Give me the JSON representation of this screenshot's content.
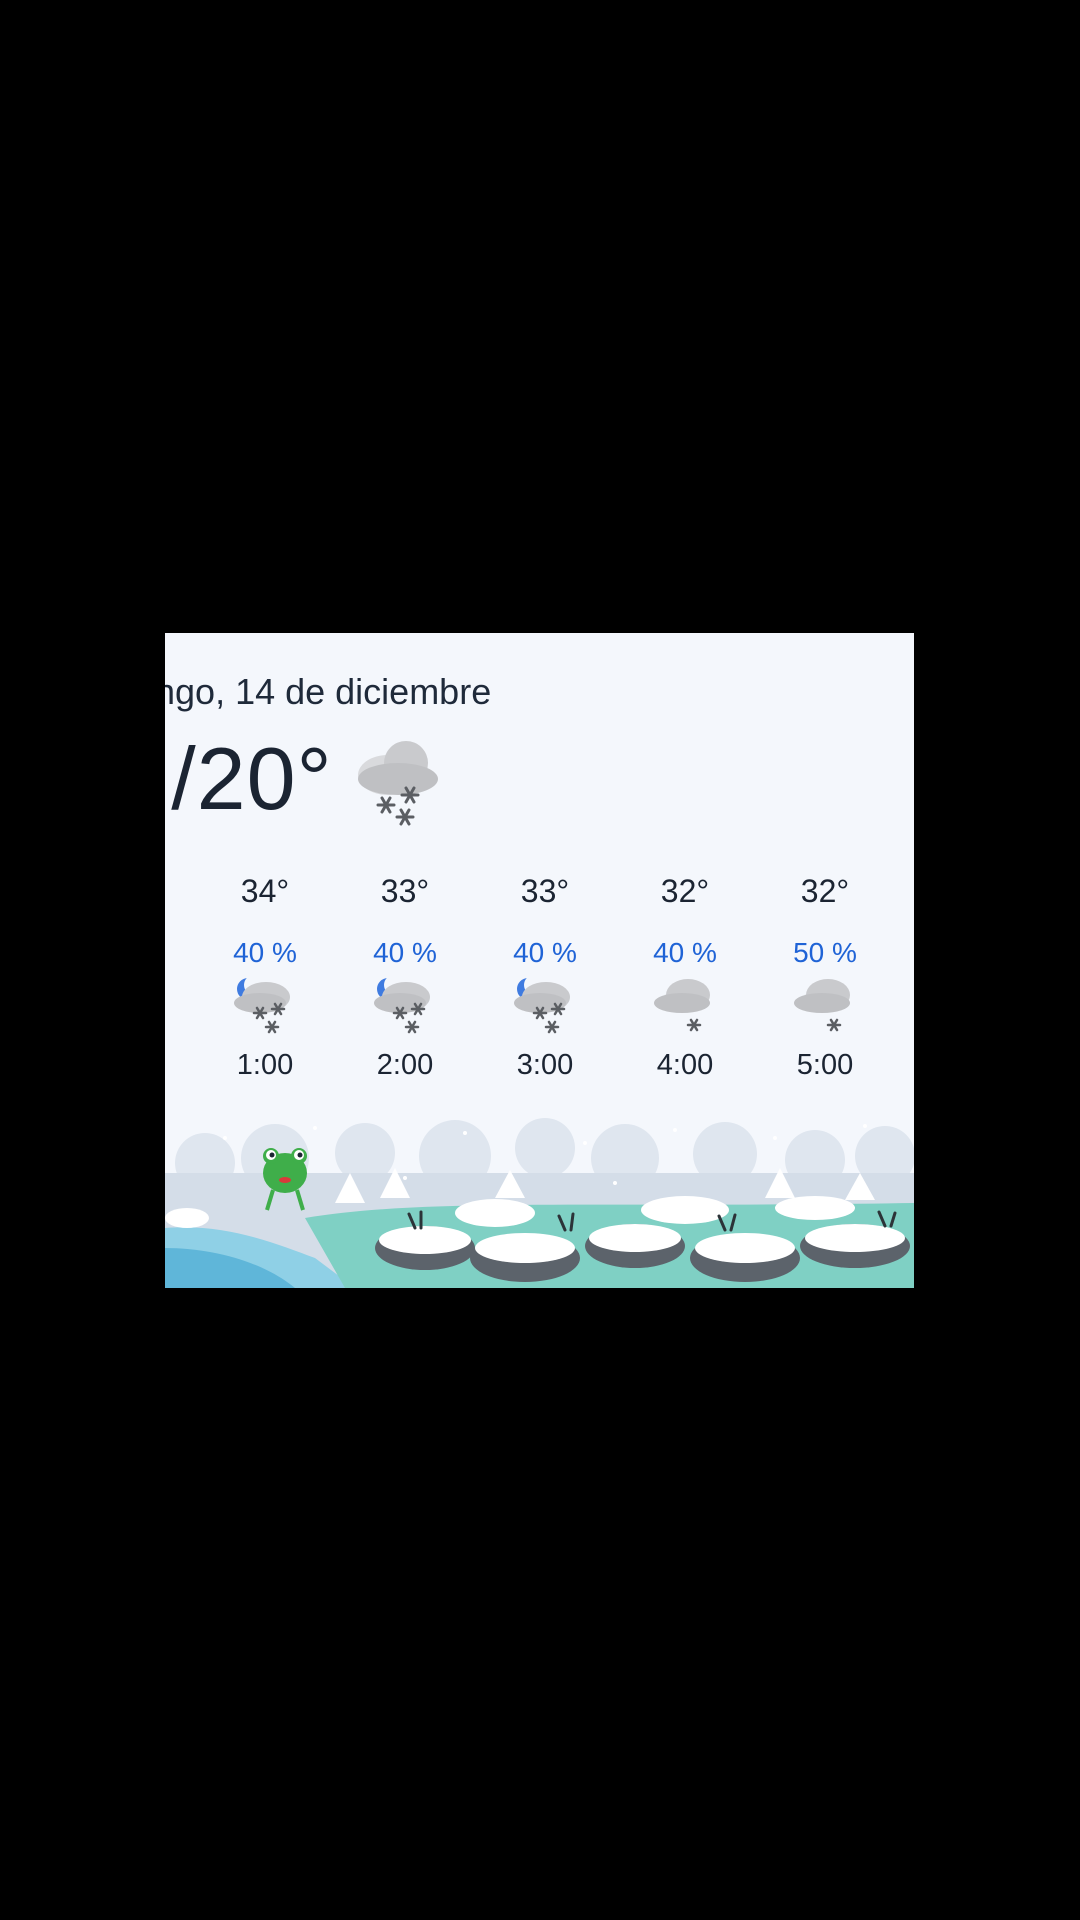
{
  "header": {
    "date": "ngo, 14 de diciembre",
    "temp_range": "°/20°",
    "icon": "snow-cloud-icon"
  },
  "hourly": [
    {
      "temp": "34°",
      "precip": "40 %",
      "time": "1:00",
      "icon": "night-snow-icon"
    },
    {
      "temp": "33°",
      "precip": "40 %",
      "time": "2:00",
      "icon": "night-snow-icon"
    },
    {
      "temp": "33°",
      "precip": "40 %",
      "time": "3:00",
      "icon": "night-snow-icon"
    },
    {
      "temp": "32°",
      "precip": "40 %",
      "time": "4:00",
      "icon": "light-snow-icon"
    },
    {
      "temp": "32°",
      "precip": "50 %",
      "time": "5:00",
      "icon": "light-snow-icon"
    }
  ],
  "colors": {
    "background": "#f4f7fc",
    "text": "#1b2432",
    "precip": "#1f63d6"
  },
  "scene": {
    "icon": "snowy-landscape-frog-illustration"
  }
}
